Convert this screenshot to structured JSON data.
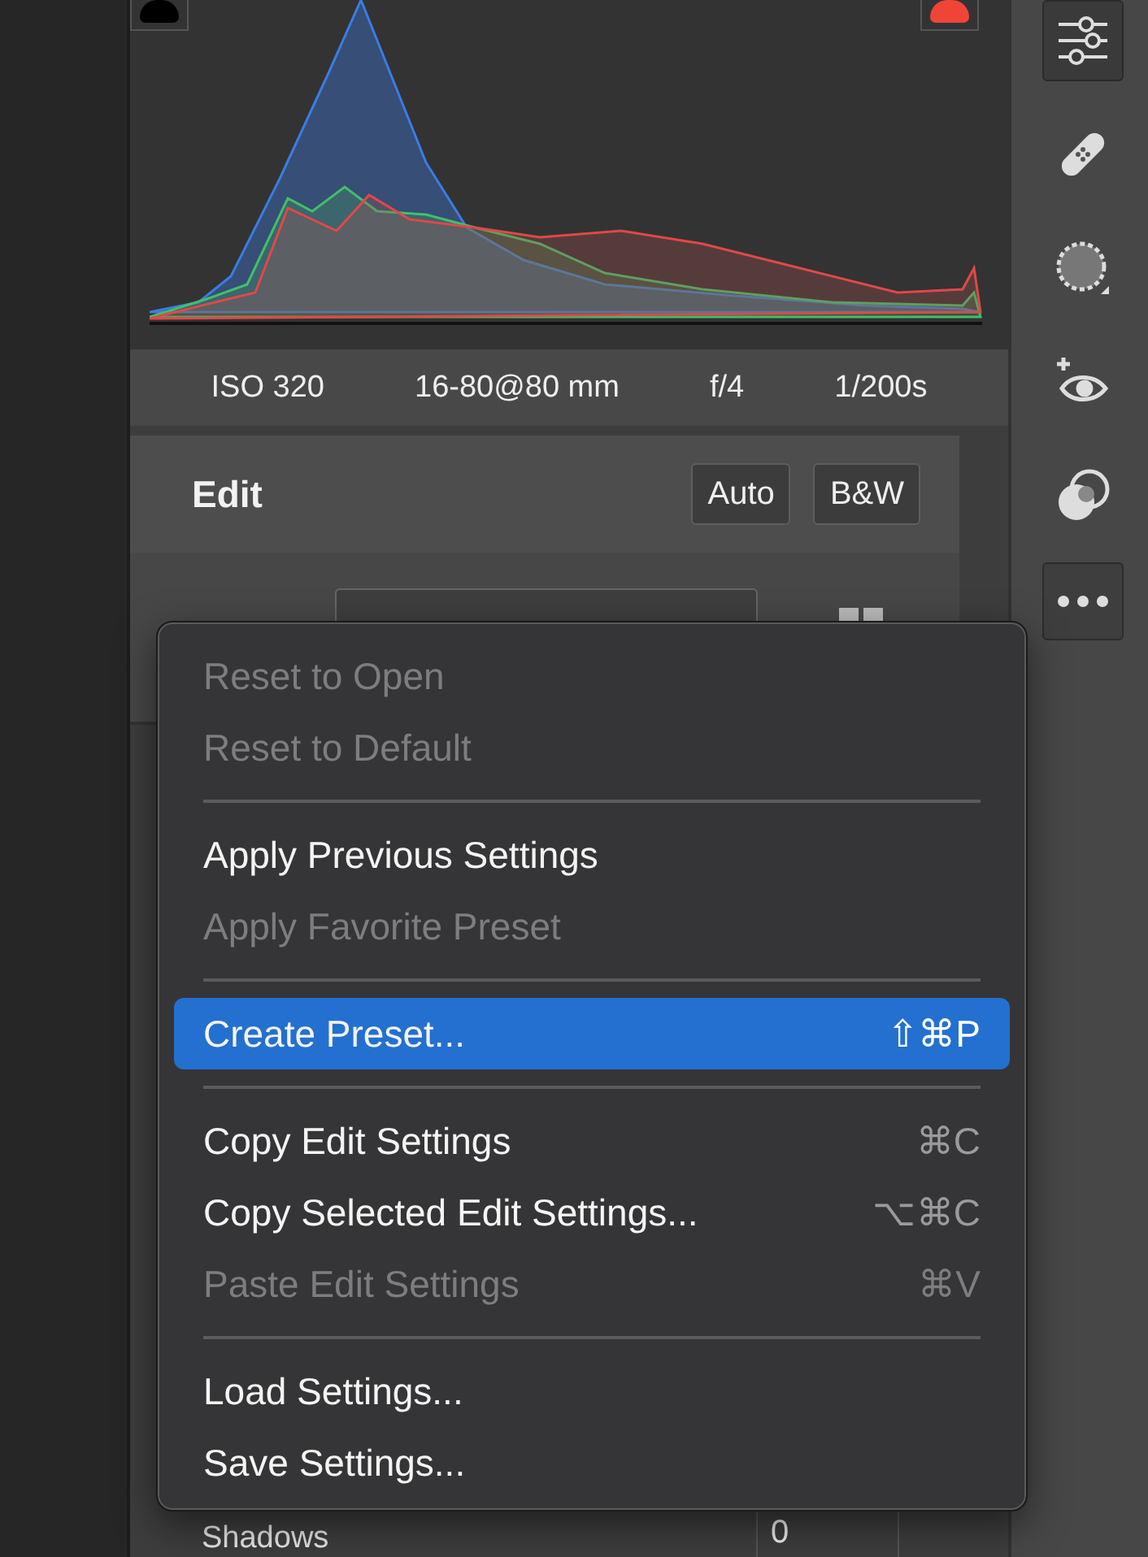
{
  "shadow_clipping": {
    "on": false
  },
  "highlight_clipping": {
    "on": false
  },
  "exposure_info": [
    "ISO 320",
    "16-80@80 mm",
    "f/4",
    "1/200s"
  ],
  "edit_panel": {
    "title": "Edit",
    "buttons": [
      "Auto",
      "B&W"
    ]
  },
  "shadows": {
    "label": "Shadows",
    "value": "0"
  },
  "tools": [
    {
      "kind": "sliders",
      "selected": true
    },
    {
      "kind": "bandage",
      "selected": false
    },
    {
      "kind": "mask",
      "selected": false
    },
    {
      "kind": "redeye",
      "selected": false
    },
    {
      "kind": "presets",
      "selected": false
    }
  ],
  "menu": [
    {
      "kind": "item",
      "label": "Reset to Open",
      "disabled": true,
      "selected": false
    },
    {
      "kind": "item",
      "label": "Reset to Default",
      "disabled": true,
      "selected": false
    },
    {
      "kind": "separator"
    },
    {
      "kind": "item",
      "label": "Apply Previous Settings",
      "disabled": false,
      "selected": false
    },
    {
      "kind": "item",
      "label": "Apply Favorite Preset",
      "disabled": true,
      "selected": false
    },
    {
      "kind": "separator"
    },
    {
      "kind": "item",
      "label": "Create Preset...",
      "shortcut": "⇧⌘P",
      "disabled": false,
      "selected": true
    },
    {
      "kind": "separator"
    },
    {
      "kind": "item",
      "label": "Copy Edit Settings",
      "shortcut": "⌘C",
      "disabled": false,
      "selected": false
    },
    {
      "kind": "item",
      "label": "Copy Selected Edit Settings...",
      "shortcut": "⌥⌘C",
      "disabled": false,
      "selected": false
    },
    {
      "kind": "item",
      "label": "Paste Edit Settings",
      "shortcut": "⌘V",
      "disabled": true,
      "selected": false
    },
    {
      "kind": "separator"
    },
    {
      "kind": "item",
      "label": "Load Settings...",
      "disabled": false,
      "selected": false
    },
    {
      "kind": "item",
      "label": "Save Settings...",
      "disabled": false,
      "selected": false
    }
  ]
}
